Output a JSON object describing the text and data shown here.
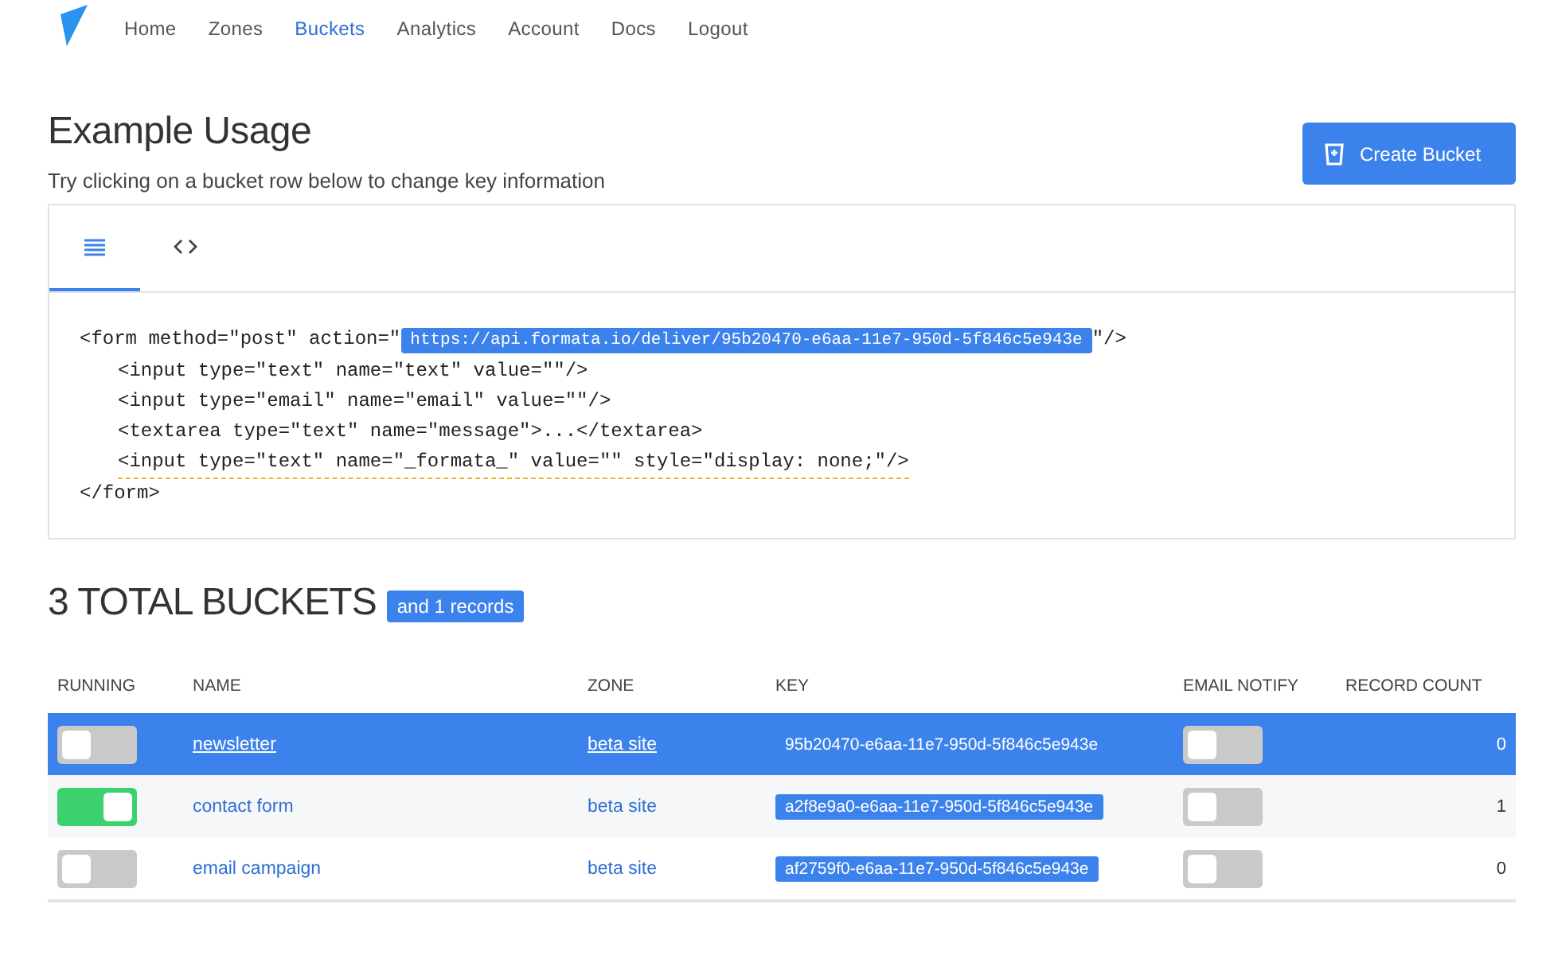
{
  "nav": {
    "items": [
      {
        "label": "Home",
        "selected": false
      },
      {
        "label": "Zones",
        "selected": false
      },
      {
        "label": "Buckets",
        "selected": true
      },
      {
        "label": "Analytics",
        "selected": false
      },
      {
        "label": "Account",
        "selected": false
      },
      {
        "label": "Docs",
        "selected": false
      },
      {
        "label": "Logout",
        "selected": false
      }
    ]
  },
  "header": {
    "title": "Example Usage",
    "subtitle": "Try clicking on a bucket row below to change key information",
    "create_button": "Create Bucket"
  },
  "code_panel": {
    "tabs": [
      {
        "kind": "list",
        "selected": true
      },
      {
        "kind": "code",
        "selected": false
      }
    ],
    "lines": [
      {
        "segments": [
          {
            "kind": "text",
            "text": "<form method=\"post\" action=\""
          },
          {
            "kind": "highlight",
            "text": "https://api.formata.io/deliver/95b20470-e6aa-11e7-950d-5f846c5e943e"
          },
          {
            "kind": "text",
            "text": "\"/>"
          }
        ],
        "underlined": false,
        "children": [
          {
            "segments": [
              {
                "kind": "text",
                "text": "<input type=\"text\" name=\"text\" value=\"\"/>"
              }
            ],
            "underlined": false
          },
          {
            "segments": [
              {
                "kind": "text",
                "text": "<input type=\"email\" name=\"email\" value=\"\"/>"
              }
            ],
            "underlined": false
          },
          {
            "segments": [
              {
                "kind": "text",
                "text": "<textarea type=\"text\" name=\"message\">...</textarea>"
              }
            ],
            "underlined": false
          },
          {
            "segments": [
              {
                "kind": "text",
                "text": "<input type=\"text\" name=\"_formata_\" value=\"\" style=\"display: none;\"/>"
              }
            ],
            "underlined": true
          }
        ]
      },
      {
        "segments": [
          {
            "kind": "text",
            "text": "</form>"
          }
        ],
        "underlined": false
      }
    ]
  },
  "buckets": {
    "title": "3 TOTAL BUCKETS",
    "badge": "and 1 records",
    "columns": [
      "RUNNING",
      "NAME",
      "ZONE",
      "KEY",
      "EMAIL NOTIFY",
      "RECORD COUNT"
    ],
    "rows": [
      {
        "selected": true,
        "running": false,
        "name": "newsletter",
        "zone": "beta site",
        "key": "95b20470-e6aa-11e7-950d-5f846c5e943e",
        "email_notify": false,
        "record_count": "0"
      },
      {
        "selected": false,
        "running": true,
        "name": "contact form",
        "zone": "beta site",
        "key": "a2f8e9a0-e6aa-11e7-950d-5f846c5e943e",
        "email_notify": false,
        "record_count": "1"
      },
      {
        "selected": false,
        "running": false,
        "name": "email campaign",
        "zone": "beta site",
        "key": "af2759f0-e6aa-11e7-950d-5f846c5e943e",
        "email_notify": false,
        "record_count": "0"
      }
    ]
  }
}
